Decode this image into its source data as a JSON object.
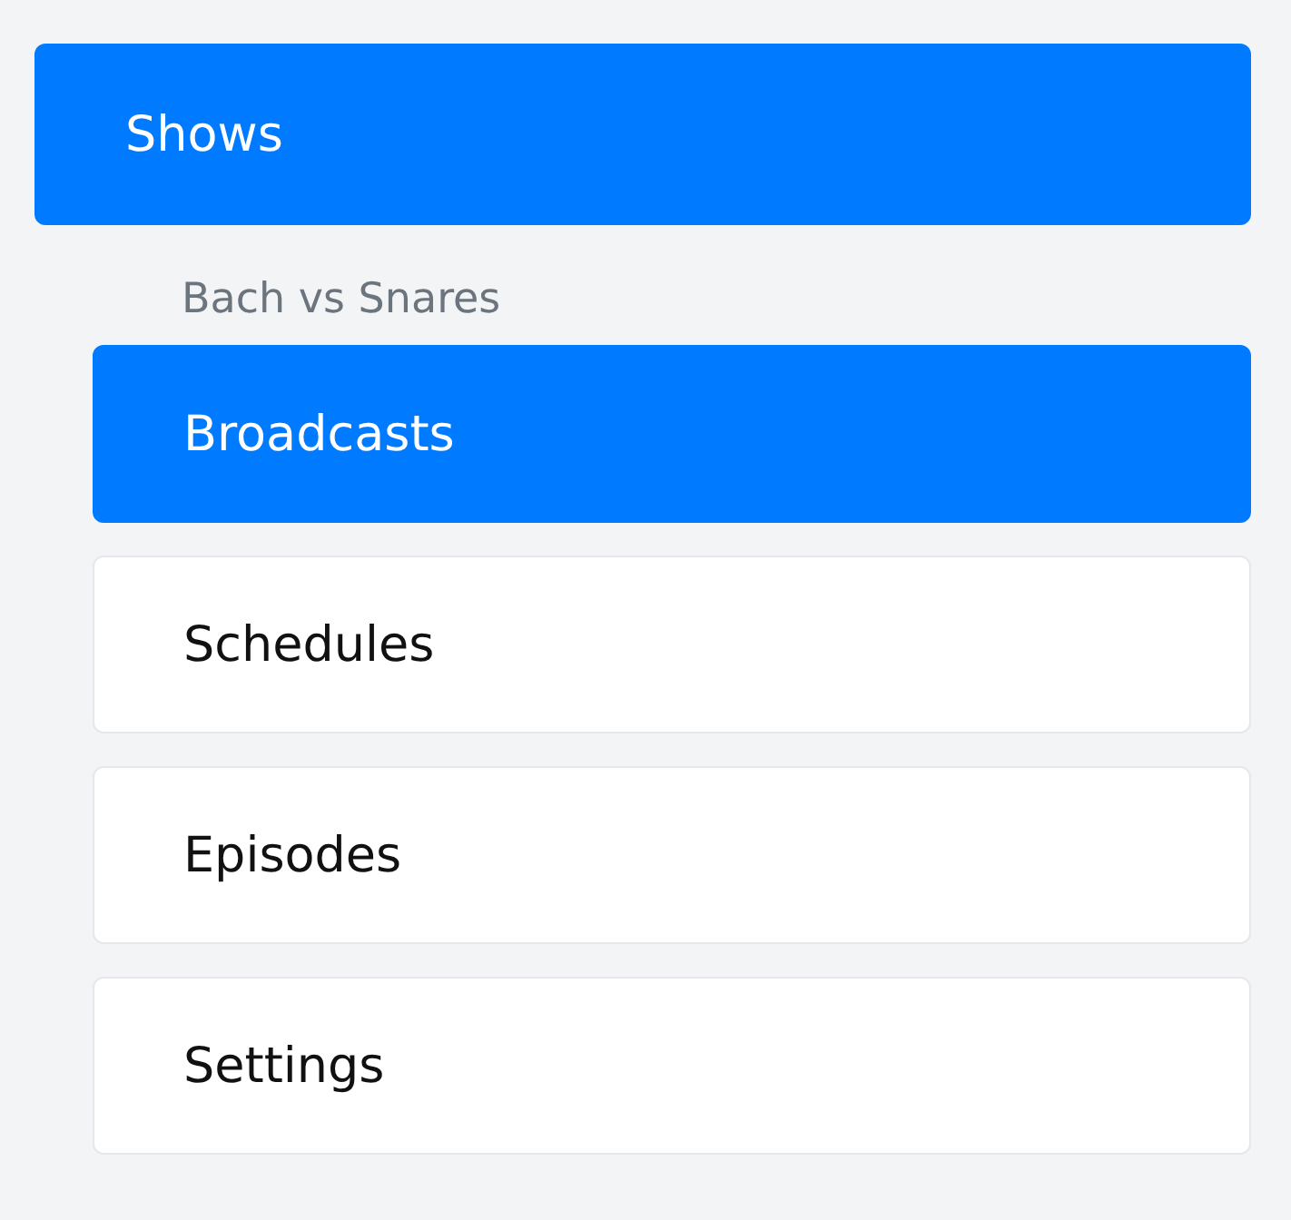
{
  "nav": {
    "label": "Shows",
    "selected": true
  },
  "section": {
    "label": "Bach vs Snares",
    "items": [
      {
        "label": "Broadcasts",
        "selected": true
      },
      {
        "label": "Schedules",
        "selected": false
      },
      {
        "label": "Episodes",
        "selected": false
      },
      {
        "label": "Settings",
        "selected": false
      }
    ]
  }
}
